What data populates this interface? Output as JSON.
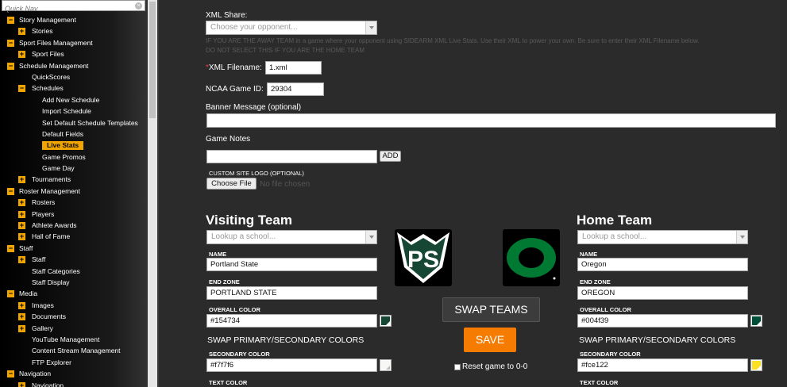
{
  "sidebar": {
    "quicknav_placeholder": "Quick Nav",
    "tree": [
      {
        "level": 0,
        "label": "Story Management",
        "toggle": "-"
      },
      {
        "level": 1,
        "label": "Stories",
        "toggle": "+"
      },
      {
        "level": 0,
        "label": "Sport Files Management",
        "toggle": "-"
      },
      {
        "level": 1,
        "label": "Sport Files",
        "toggle": "+"
      },
      {
        "level": 0,
        "label": "Schedule Management",
        "toggle": "-"
      },
      {
        "level": 1,
        "label": "QuickScores",
        "toggle": ""
      },
      {
        "level": 1,
        "label": "Schedules",
        "toggle": "-"
      },
      {
        "level": 2,
        "label": "Add New Schedule"
      },
      {
        "level": 2,
        "label": "Import Schedule"
      },
      {
        "level": 2,
        "label": "Set Default Schedule Templates"
      },
      {
        "level": 2,
        "label": "Default Fields"
      },
      {
        "level": 2,
        "label": "Live Stats",
        "active": true
      },
      {
        "level": 2,
        "label": "Game Promos"
      },
      {
        "level": 2,
        "label": "Game Day"
      },
      {
        "level": 1,
        "label": "Tournaments",
        "toggle": "+"
      },
      {
        "level": 0,
        "label": "Roster Management",
        "toggle": "-"
      },
      {
        "level": 1,
        "label": "Rosters",
        "toggle": "+"
      },
      {
        "level": 1,
        "label": "Players",
        "toggle": "+"
      },
      {
        "level": 1,
        "label": "Athlete Awards",
        "toggle": "+"
      },
      {
        "level": 1,
        "label": "Hall of Fame",
        "toggle": "+"
      },
      {
        "level": 0,
        "label": "Staff",
        "toggle": "-"
      },
      {
        "level": 1,
        "label": "Staff",
        "toggle": "+"
      },
      {
        "level": 1,
        "label": "Staff Categories",
        "toggle": ""
      },
      {
        "level": 1,
        "label": "Staff Display",
        "toggle": ""
      },
      {
        "level": 0,
        "label": "Media",
        "toggle": "-"
      },
      {
        "level": 1,
        "label": "Images",
        "toggle": "+"
      },
      {
        "level": 1,
        "label": "Documents",
        "toggle": "+"
      },
      {
        "level": 1,
        "label": "Gallery",
        "toggle": "+"
      },
      {
        "level": 1,
        "label": "YouTube Management",
        "toggle": ""
      },
      {
        "level": 1,
        "label": "Content Stream Management",
        "toggle": ""
      },
      {
        "level": 1,
        "label": "FTP Explorer",
        "toggle": ""
      },
      {
        "level": 0,
        "label": "Navigation",
        "toggle": "-"
      },
      {
        "level": 1,
        "label": "Navigation",
        "toggle": "+"
      }
    ]
  },
  "form": {
    "xml_share_label": "XML Share:",
    "xml_share_placeholder": "Choose your opponent...",
    "xml_share_help_1": "IF YOU ARE THE AWAY TEAM in a game where your opponent using SIDEARM XML Live Stats. Use their XML to power your own. Be sure to enter their XML Filename below.",
    "xml_share_help_2": "DO NOT SELECT THIS IF YOU ARE THE HOME TEAM",
    "required_mark": "*",
    "xml_filename_label": "XML Filename:",
    "xml_filename_value": "1.xml",
    "ncaa_game_id_label": "NCAA Game ID:",
    "ncaa_game_id_value": "29304",
    "banner_label": "Banner Message (optional)",
    "banner_value": "",
    "game_notes_label": "Game Notes",
    "game_notes_value": "",
    "add_label": "ADD",
    "custom_logo_label": "CUSTOM SITE LOGO (OPTIONAL)",
    "choose_file_label": "Choose File",
    "no_file_label": "No file chosen"
  },
  "visiting": {
    "title": "Visiting Team",
    "lookup_placeholder": "Lookup a school...",
    "name_label": "NAME",
    "name_value": "Portland State",
    "endzone_label": "END ZONE",
    "endzone_value": "PORTLAND STATE",
    "overall_color_label": "OVERALL COLOR",
    "overall_color_value": "#154734",
    "swap_colors_label": "SWAP PRIMARY/SECONDARY COLORS",
    "secondary_color_label": "SECONDARY COLOR",
    "secondary_color_value": "#f7f7f6",
    "text_color_label": "TEXT COLOR",
    "logo_text": "PS"
  },
  "home": {
    "title": "Home Team",
    "lookup_placeholder": "Lookup a school...",
    "name_label": "NAME",
    "name_value": "Oregon",
    "endzone_label": "END ZONE",
    "endzone_value": "OREGON",
    "overall_color_label": "OVERALL COLOR",
    "overall_color_value": "#004f39",
    "swap_colors_label": "SWAP PRIMARY/SECONDARY COLORS",
    "secondary_color_label": "SECONDARY COLOR",
    "secondary_color_value": "#fce122",
    "text_color_label": "TEXT COLOR"
  },
  "actions": {
    "swap_teams_label": "SWAP TEAMS",
    "save_label": "SAVE",
    "reset_label": "Reset game to 0-0"
  },
  "colors": {
    "accent": "#f0a500",
    "save": "#f57c00",
    "ps_green": "#154734",
    "oregon_green": "#007a33",
    "oregon_yellow": "#fce122"
  }
}
